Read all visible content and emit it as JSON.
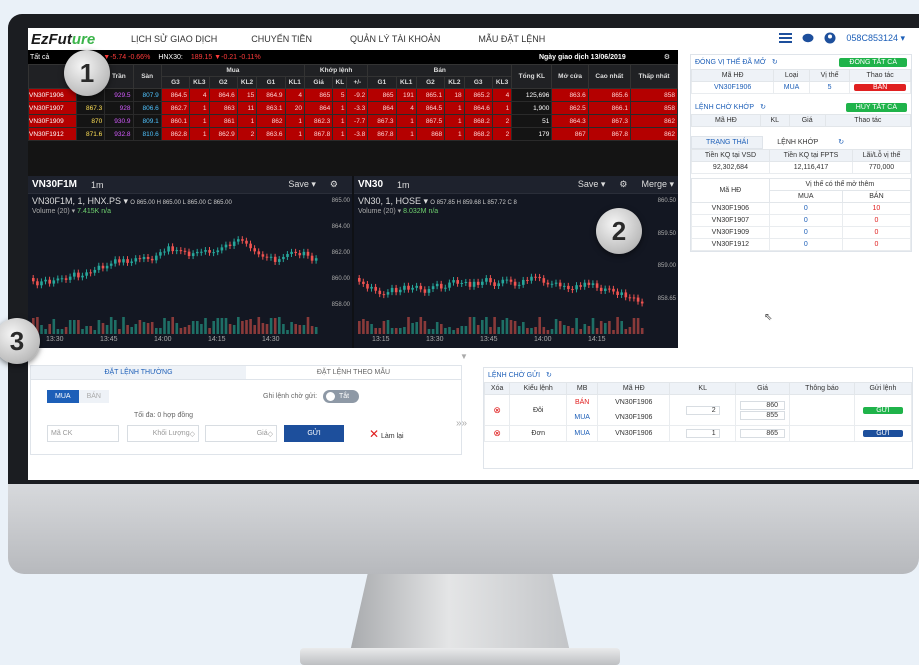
{
  "nav": {
    "logo_main": "EzFut",
    "logo_accent": "ure",
    "items": [
      "LỊCH SỬ GIAO DỊCH",
      "CHUYỂN TIỀN",
      "QUẢN LÝ TÀI KHOẢN",
      "MẪU ĐẶT LỆNH"
    ],
    "account": "058C853124 ▾"
  },
  "ticker": {
    "label": "Tất cả",
    "vn30": "6 ▼-5.74 -0.66%",
    "hnx30_label": "HNX30:",
    "hnx30": "189.15 ▼-0.21 -0.11%",
    "trade_date": "Ngày giao dịch 13/06/2019"
  },
  "board": {
    "group_headers": {
      "buy": "Mua",
      "match": "Khớp lệnh",
      "sell": "Bán"
    },
    "headers": [
      "Trần",
      "Sàn",
      "G3",
      "KL3",
      "G2",
      "KL2",
      "G1",
      "KL1",
      "Giá",
      "KL",
      "+/-",
      "G1",
      "KL1",
      "G2",
      "KL2",
      "G3",
      "KL3",
      "Tổng KL",
      "Mở cửa",
      "Cao nhất",
      "Thấp nhất"
    ],
    "rows": [
      {
        "code": "VN30F1906",
        "ref": "",
        "ceil": "929.5",
        "floor": "807.9",
        "cells": [
          "864.5",
          "4",
          "864.6",
          "15",
          "864.9",
          "4",
          "865",
          "5",
          "-9.2",
          "865",
          "191",
          "865.1",
          "18",
          "865.2",
          "4"
        ],
        "total": "125,696",
        "open": "863.6",
        "high": "865.6",
        "low": "858"
      },
      {
        "code": "VN30F1907",
        "ref": "867.3",
        "ceil": "928",
        "floor": "806.6",
        "cells": [
          "862.7",
          "1",
          "863",
          "11",
          "863.1",
          "20",
          "864",
          "1",
          "-3.3",
          "864",
          "4",
          "864.5",
          "1",
          "864.6",
          "1"
        ],
        "total": "1,900",
        "open": "862.5",
        "high": "866.1",
        "low": "858"
      },
      {
        "code": "VN30F1909",
        "ref": "870",
        "ceil": "930.9",
        "floor": "809.1",
        "cells": [
          "860.1",
          "1",
          "861",
          "1",
          "862",
          "1",
          "862.3",
          "1",
          "-7.7",
          "867.3",
          "1",
          "867.5",
          "1",
          "868.2",
          "2"
        ],
        "total": "51",
        "open": "864.3",
        "high": "867.3",
        "low": "862"
      },
      {
        "code": "VN30F1912",
        "ref": "871.6",
        "ceil": "932.8",
        "floor": "810.6",
        "cells": [
          "862.8",
          "1",
          "862.9",
          "2",
          "863.6",
          "1",
          "867.8",
          "1",
          "-3.8",
          "867.8",
          "1",
          "868",
          "1",
          "868.2",
          "2"
        ],
        "total": "179",
        "open": "867",
        "high": "867.8",
        "low": "862"
      }
    ]
  },
  "chart1": {
    "symbol": "VN30F1M",
    "interval": "1m",
    "title": "VN30F1M, 1, HNX.PS ▾",
    "ohlc": "O 865.00 H 865.00 L 865.00 C 865.00",
    "vol": "Volume (20) ▾",
    "vol_val": "7.415K  n/a",
    "y_ticks": [
      "865.00",
      "864.00",
      "862.00",
      "860.00",
      "858.00"
    ],
    "x_ticks": [
      "13:30",
      "13:45",
      "14:00",
      "14:15",
      "14:30"
    ],
    "save": "Save ▾"
  },
  "chart2": {
    "symbol": "VN30",
    "interval": "1m",
    "title": "VN30, 1, HOSE ▾",
    "ohlc": "O 857.85 H 859.68 L 857.72 C 8",
    "vol": "Volume (20) ▾",
    "vol_val": "8.032M  n/a",
    "y_ticks": [
      "860.50",
      "859.50",
      "859.00",
      "858.65"
    ],
    "x_ticks": [
      "13:15",
      "13:30",
      "13:45",
      "14:00",
      "14:15"
    ],
    "save": "Save ▾",
    "merge": "Merge ▾"
  },
  "positions": {
    "title": "ĐÓNG VỊ THẾ ĐÃ MỞ",
    "close_all": "ĐÓNG TẤT CẢ",
    "headers": [
      "Mã HĐ",
      "Loại",
      "Vị thế",
      "Thao tác"
    ],
    "row": {
      "code": "VN30F1906",
      "type": "MUA",
      "qty": "5",
      "action": "BÁN"
    }
  },
  "waiting_match": {
    "title": "LỆNH CHỜ KHỚP",
    "cancel_all": "HỦY TẤT CẢ",
    "headers": [
      "Mã HĐ",
      "KL",
      "Giá",
      "Thao tác"
    ]
  },
  "status": {
    "tab1": "TRẠNG THÁI",
    "tab2": "LỆNH KHỚP",
    "headers": [
      "Tiền KQ tại VSD",
      "Tiền KQ tại FPTS",
      "Lãi/Lỗ vị thế"
    ],
    "values": [
      "92,302,684",
      "12,116,417",
      "770,000"
    ],
    "pos_hdr": "Vị thế có thể mở thêm",
    "code_hdr": "Mã HĐ",
    "buy": "MUA",
    "sell": "BÁN",
    "rows": [
      {
        "code": "VN30F1906",
        "buy": "0",
        "sell": "10"
      },
      {
        "code": "VN30F1907",
        "buy": "0",
        "sell": "0"
      },
      {
        "code": "VN30F1909",
        "buy": "0",
        "sell": "0"
      },
      {
        "code": "VN30F1912",
        "buy": "0",
        "sell": "0"
      }
    ]
  },
  "order": {
    "tab1": "ĐẶT LỆNH THƯỜNG",
    "tab2": "ĐẶT LỆNH THEO MẪU",
    "buy": "MUA",
    "sell": "BÁN",
    "pending_toggle": "Ghi lệnh chờ gửi:",
    "toggle_state": "Tắt",
    "max": "Tối đa: 0 hợp đồng",
    "code_ph": "Mã CK",
    "qty_ph": "Khối Lượng",
    "price_ph": "Giá",
    "send": "GỬI",
    "reset": "Làm lại"
  },
  "pending": {
    "title": "LỆNH CHỜ GỬI",
    "headers": [
      "Xóa",
      "Kiểu lệnh",
      "MB",
      "Mã HĐ",
      "KL",
      "Giá",
      "Thông báo",
      "Gửi lệnh"
    ],
    "rows": [
      {
        "type": "Đôi",
        "side1": "BÁN",
        "side2": "MUA",
        "code1": "VN30F1906",
        "code2": "VN30F1906",
        "qty": "2",
        "price1": "860",
        "price2": "855",
        "send": "GỬI"
      },
      {
        "type": "Đơn",
        "side1": "MUA",
        "code1": "VN30F1906",
        "qty": "1",
        "price1": "865",
        "send": "GỬI"
      }
    ]
  },
  "badges": [
    "1",
    "2",
    "3"
  ]
}
